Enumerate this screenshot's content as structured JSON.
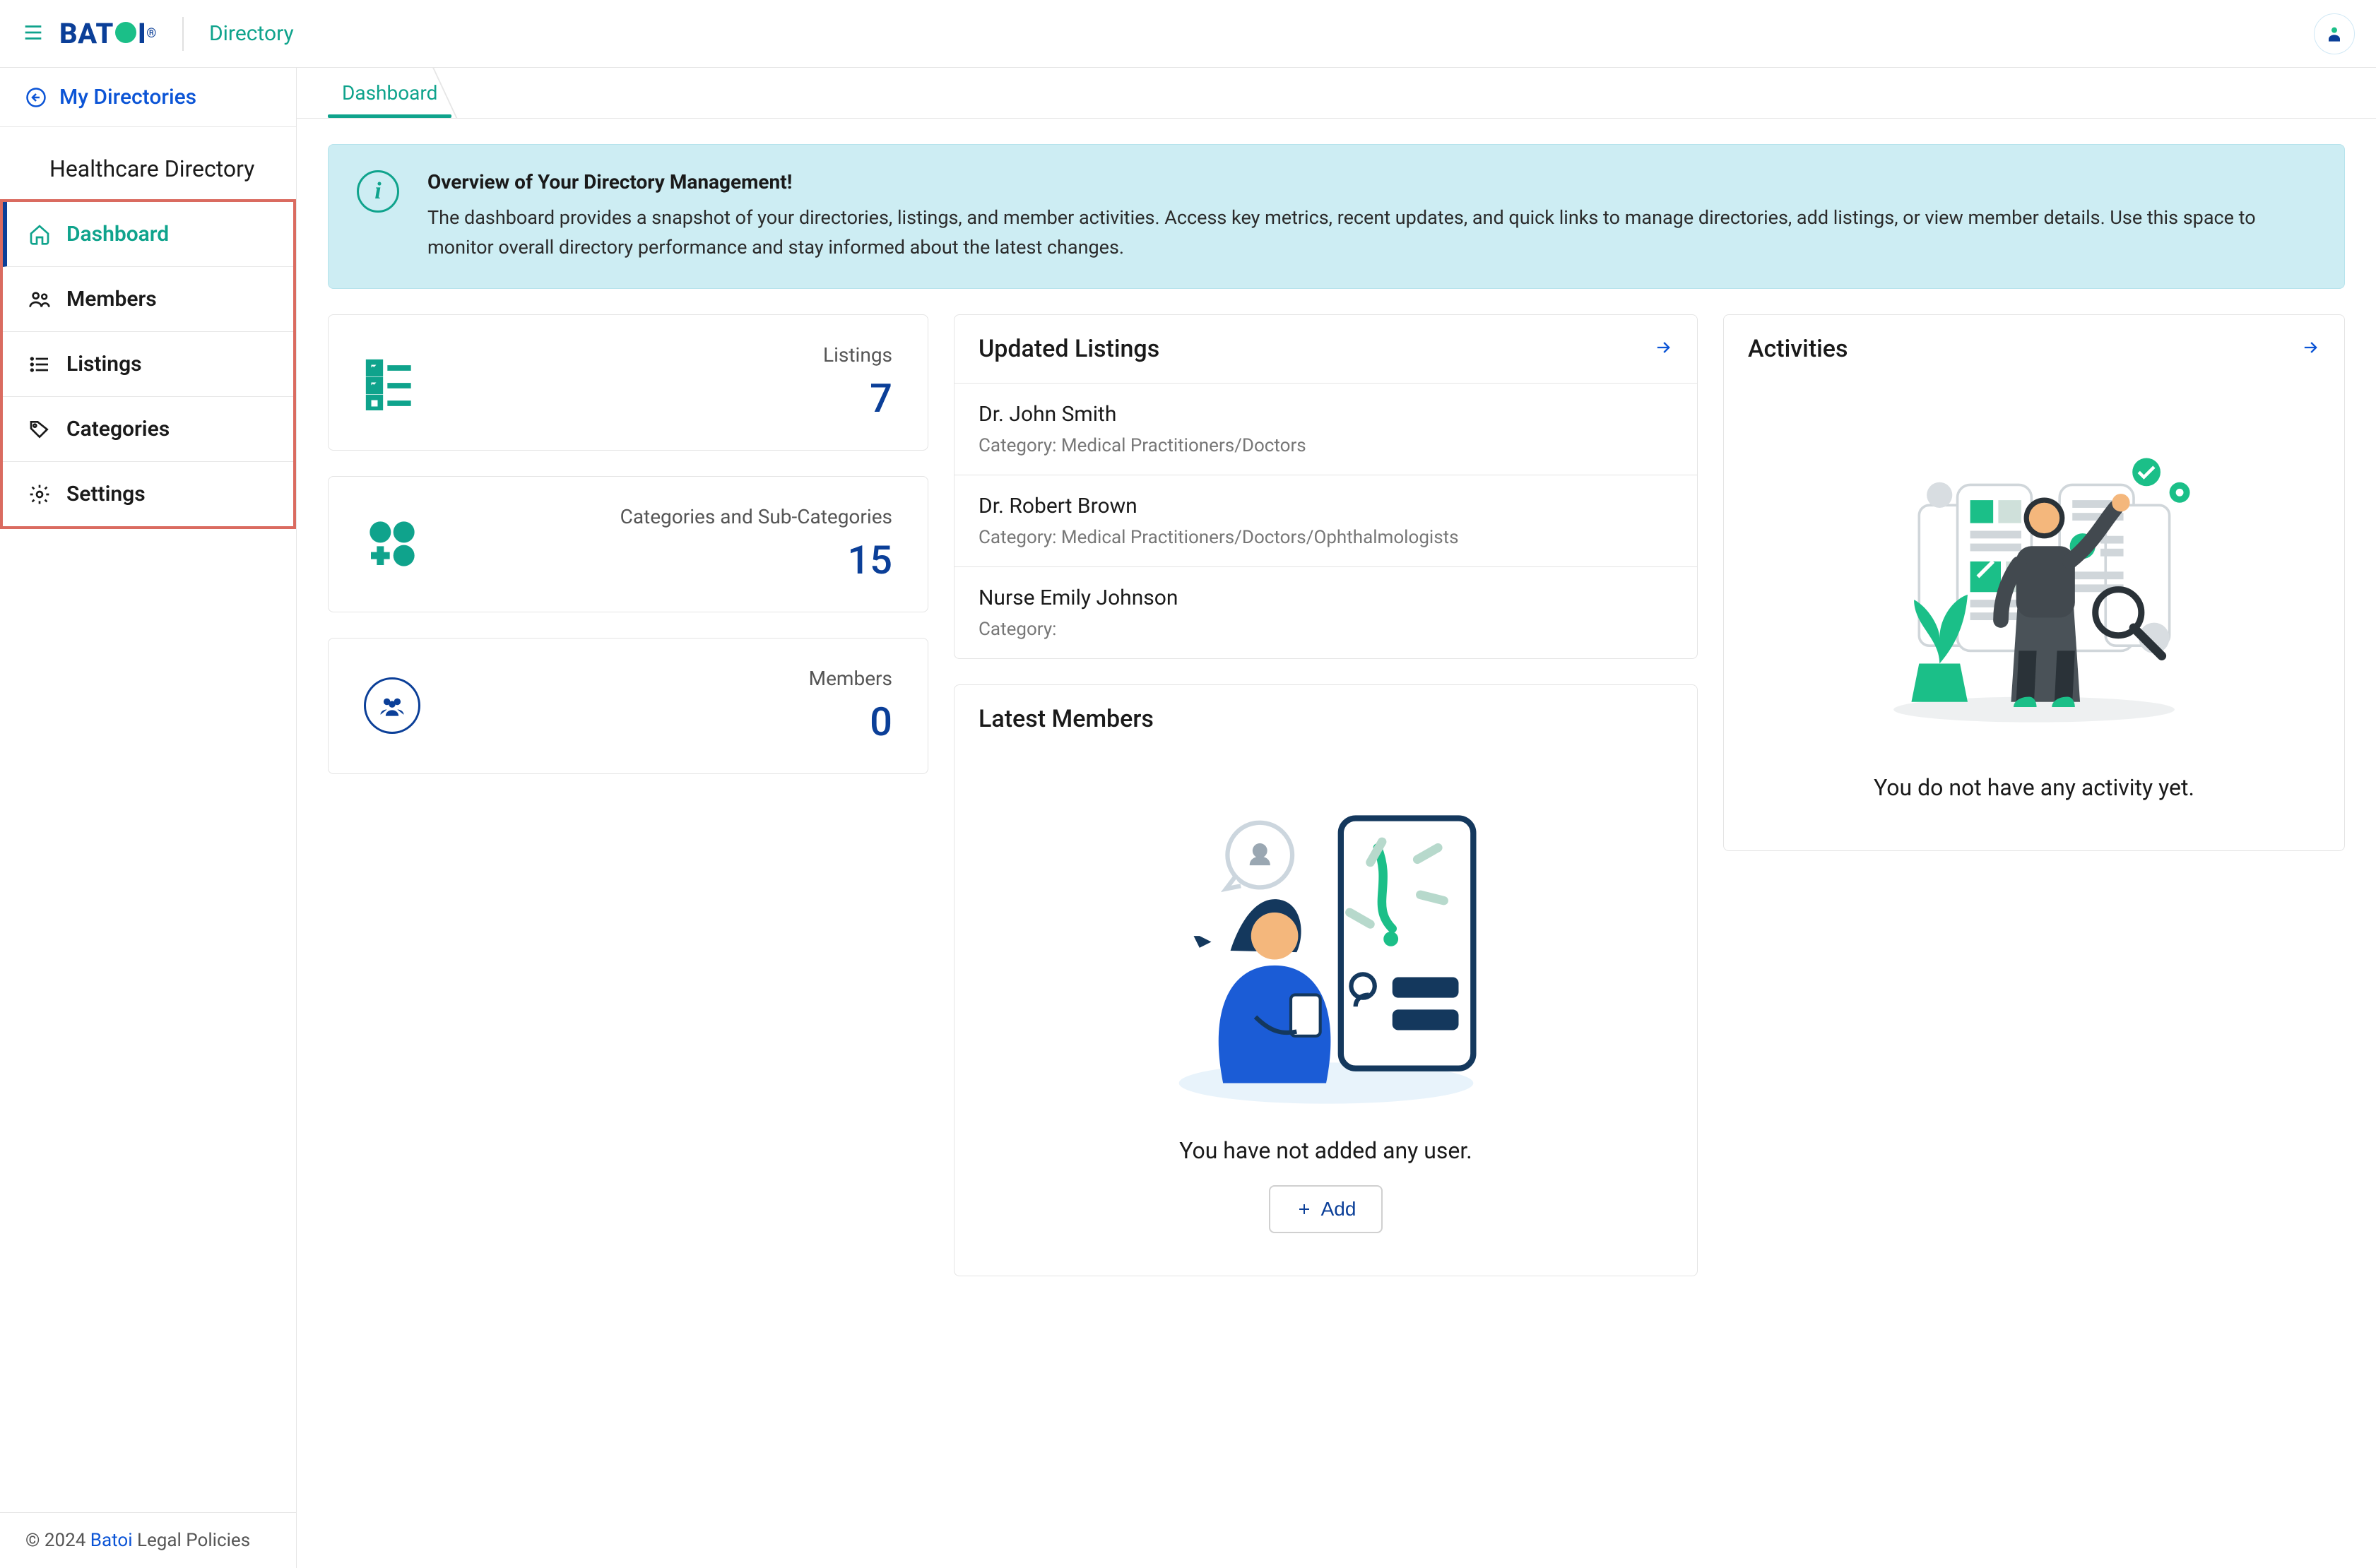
{
  "header": {
    "logo_prefix": "BAT",
    "logo_suffix": "I",
    "app_name": "Directory"
  },
  "sidebar": {
    "back_label": "My Directories",
    "directory_title": "Healthcare Directory",
    "items": [
      {
        "label": "Dashboard"
      },
      {
        "label": "Members"
      },
      {
        "label": "Listings"
      },
      {
        "label": "Categories"
      },
      {
        "label": "Settings"
      }
    ]
  },
  "footer": {
    "copyright_prefix": "© 2024 ",
    "brand": "Batoi",
    "legal": " Legal Policies"
  },
  "tabs": {
    "dashboard": "Dashboard"
  },
  "overview": {
    "title": "Overview of Your Directory Management!",
    "body": "The dashboard provides a snapshot of your directories, listings, and member activities. Access key metrics, recent updates, and quick links to manage directories, add listings, or view member details. Use this space to monitor overall directory performance and stay informed about the latest changes."
  },
  "stats": {
    "listings_label": "Listings",
    "listings_value": "7",
    "categories_label": "Categories and Sub-Categories",
    "categories_value": "15",
    "members_label": "Members",
    "members_value": "0"
  },
  "updated_listings": {
    "title": "Updated Listings",
    "rows": [
      {
        "name": "Dr. John Smith",
        "category": "Category: Medical Practitioners/Doctors"
      },
      {
        "name": "Dr. Robert Brown",
        "category": "Category: Medical Practitioners/Doctors/Ophthalmologists"
      },
      {
        "name": "Nurse Emily Johnson",
        "category": "Category:"
      }
    ]
  },
  "latest_members": {
    "title": "Latest Members",
    "empty_text": "You have not added any user.",
    "add_label": "Add"
  },
  "activities": {
    "title": "Activities",
    "empty_text": "You do not have any activity yet."
  }
}
